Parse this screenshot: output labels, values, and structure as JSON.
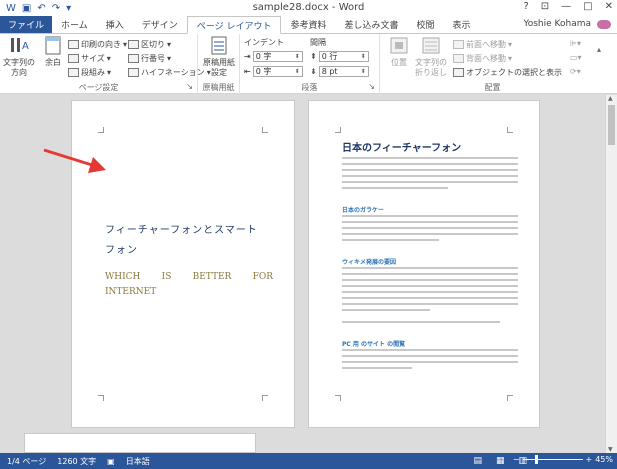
{
  "window": {
    "title": "sample28.docx - Word",
    "help": "?",
    "restore_ribbon": "⊡",
    "minimize": "—",
    "maximize": "□",
    "close": "✕"
  },
  "qat": {
    "save": "▣",
    "undo": "↶",
    "redo": "↷",
    "customize": "▾"
  },
  "tabs": [
    "ファイル",
    "ホーム",
    "挿入",
    "デザイン",
    "ページ レイアウト",
    "参考資料",
    "差し込み文書",
    "校閲",
    "表示"
  ],
  "user": "Yoshie Kohama",
  "ribbon": {
    "page_setup": {
      "label": "ページ設定",
      "text_direction": "文字列の\n方向",
      "margins": "余白",
      "orientation": "印刷の向き",
      "size": "サイズ",
      "columns": "段組み",
      "breaks": "区切り",
      "line_numbers": "行番号",
      "hyphenation": "ハイフネーション"
    },
    "manuscript": {
      "label": "原稿用紙",
      "button": "原稿用紙\n設定"
    },
    "paragraph": {
      "label": "段落",
      "indent_header": "インデント",
      "spacing_header": "間隔",
      "indent_left": "0 字",
      "indent_right": "0 字",
      "spacing_before": "0 行",
      "spacing_after": "8 pt"
    },
    "arrange": {
      "label": "配置",
      "position": "位置",
      "wrap_text": "文字列の\n折り返し",
      "bring_forward": "前面へ移動",
      "send_backward": "背面へ移動",
      "selection_pane": "オブジェクトの選択と表示"
    }
  },
  "document": {
    "cover_title_line1": "フィーチャーフォンとスマート",
    "cover_title_line2": "フォン",
    "cover_subtitle_words": [
      "WHICH",
      "IS",
      "BETTER",
      "FOR"
    ],
    "cover_subtitle_line2": "INTERNET",
    "page2_title": "日本のフィーチャーフォン",
    "page2_headings": [
      "日本のガラケー",
      "ウィキメ発展の要因",
      "PC 用 のサイト の閲覧"
    ]
  },
  "status": {
    "page": "1/4 ページ",
    "words": "1260 文字",
    "language": "日本語",
    "zoom": "45%",
    "zoom_level": 0.45
  }
}
